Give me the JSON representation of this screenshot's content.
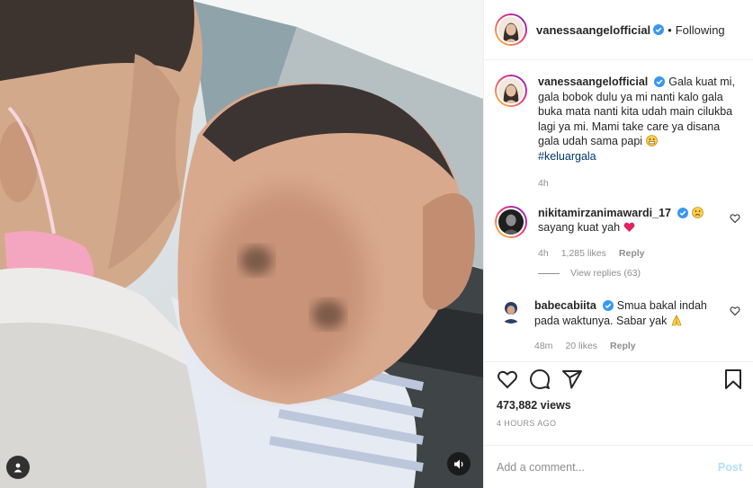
{
  "header": {
    "username": "vanessaangelofficial",
    "separator": "•",
    "follow_label": "Following",
    "avatar_icon": "profile-photo-icon"
  },
  "caption": {
    "username": "vanessaangelofficial",
    "text": "Gala kuat mi, gala bobok dulu ya mi nanti kalo gala buka mata nanti kita udah main cilukba lagi ya mi. Mami take care ya disana gala udah sama papi",
    "emoji": "grin-emoji",
    "hashtag": "#keluargala",
    "time": "4h"
  },
  "comments": [
    {
      "username": "nikitamirzanimawardi_17",
      "emoji": "frown-emoji",
      "text": "sayang kuat yah",
      "trailing_emoji": "red-heart-emoji",
      "time": "4h",
      "likes": "1,285 likes",
      "reply_label": "Reply",
      "view_replies": "View replies (63)"
    },
    {
      "username": "babecabiita",
      "text": "Smua bakal indah pada waktunya. Sabar yak",
      "trailing_emoji": "pray-emoji",
      "time": "48m",
      "likes": "20 likes",
      "reply_label": "Reply"
    }
  ],
  "actions": {
    "like_icon": "heart-icon",
    "comment_icon": "comment-icon",
    "share_icon": "share-icon",
    "save_icon": "bookmark-icon"
  },
  "stats": {
    "views": "473,882 views",
    "posted": "4 HOURS AGO"
  },
  "composer": {
    "placeholder": "Add a comment...",
    "post_label": "Post"
  },
  "media": {
    "tag_icon": "user-tag-icon",
    "sound_icon": "speaker-icon"
  },
  "colors": {
    "verified": "#3897f0",
    "hashtag": "#00376b",
    "muted": "#8e8e8e",
    "post_disabled": "#b2dffc"
  }
}
